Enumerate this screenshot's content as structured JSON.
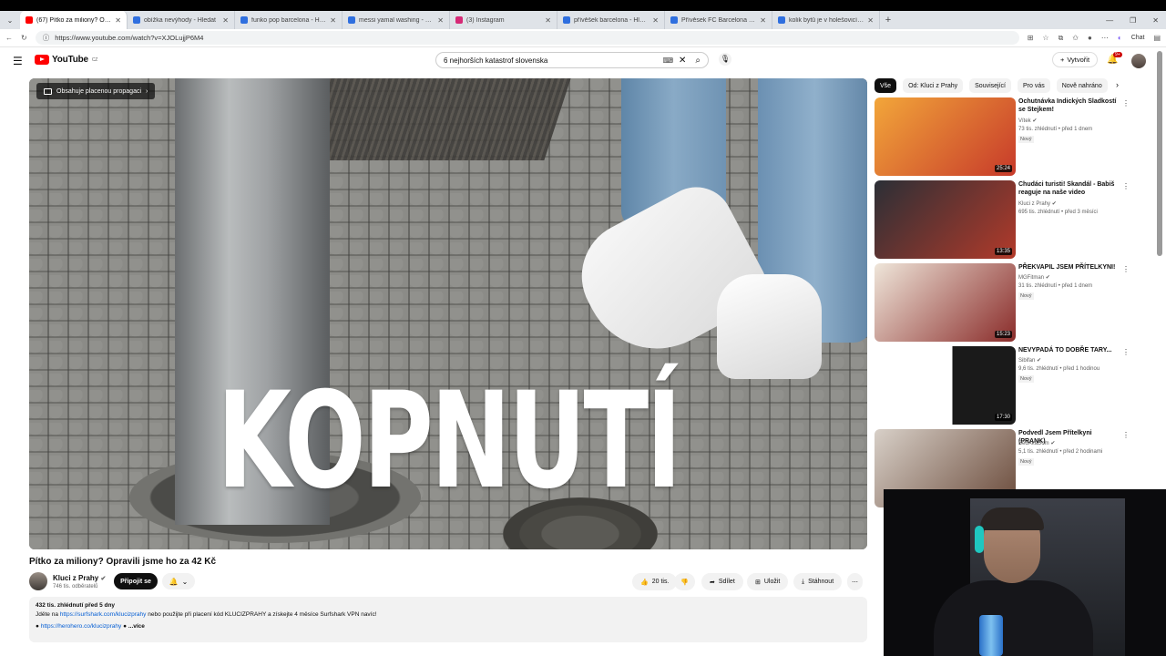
{
  "browser": {
    "tabs": [
      {
        "title": "(67) Pítko za miliony? Opravil",
        "favicon_color": "#ff0000",
        "active": true
      },
      {
        "title": "obížka nevýhody - Hledat",
        "favicon_color": "#2f6fdf"
      },
      {
        "title": "funko pop barcelona - Hledat",
        "favicon_color": "#2f6fdf"
      },
      {
        "title": "messi yamal washing - Hledat",
        "favicon_color": "#2f6fdf"
      },
      {
        "title": "(3) Instagram",
        "favicon_color": "#d62976"
      },
      {
        "title": "přívěšek barcelona - Hledat",
        "favicon_color": "#2f6fdf"
      },
      {
        "title": "Přívěsek FC Barcelona | Klíčové o",
        "favicon_color": "#2f6fdf"
      },
      {
        "title": "kolik bytů je v holešovicích - Hled",
        "favicon_color": "#2f6fdf"
      }
    ],
    "url": "https://www.youtube.com/watch?v=XJOLujjP6M4",
    "chat_label": "Chat"
  },
  "youtube": {
    "logo_text": "YouTube",
    "logo_region": "CZ",
    "search_value": "6 nejhorších katastrof slovenska",
    "create_label": "Vytvořit",
    "notifications_badge": "9+"
  },
  "video": {
    "promo_label": "Obsahuje placenou propagaci",
    "overlay_text": "KOPNUTÍ",
    "title": "Pítko za miliony? Opravili jsme ho za 42 Kč",
    "channel": "Kluci z Prahy",
    "subscribers": "746 tis. odběratelů",
    "join_label": "Připojit se",
    "likes": "20 tis.",
    "share_label": "Sdílet",
    "save_label": "Uložit",
    "download_label": "Stáhnout"
  },
  "description": {
    "meta": "432 tis. zhlédnutí  před 5 dny",
    "line_before": "Jděte na",
    "link1": "https://surfshark.com/klucizprahy",
    "line_after": "nebo použijte při placení kód KLUCIZPRAHY a získejte 4 měsíce Surfshark VPN navíc!",
    "link2": "https://herohero.co/klucizprahy",
    "more_label": "...více"
  },
  "chips": [
    "Vše",
    "Od: Kluci z Prahy",
    "Související",
    "Pro vás",
    "Nově nahráno"
  ],
  "recommendations": [
    {
      "title": "Ochutnávka Indických Sladkostí se Stejkem!",
      "channel": "Vítek",
      "views": "73 tis. zhlédnutí • před 1 dnem",
      "badge": "Nový",
      "duration": "25:24",
      "thumb": [
        "#f2a63a",
        "#c73a2a"
      ]
    },
    {
      "title": "Chudáci turisti! Skandál - Babiš reaguje na naše video",
      "channel": "Kluci z Prahy",
      "views": "695 tis. zhlédnutí • před 3 měsíci",
      "badge": "",
      "duration": "13:35",
      "thumb": [
        "#2b2f36",
        "#b23a2a"
      ]
    },
    {
      "title": "PŘEKVAPIL JSEM PŘÍTELKYNI!",
      "channel": "MGFitman",
      "views": "31 tis. zhlédnutí • před 1 dnem",
      "badge": "Nový",
      "duration": "15:23",
      "thumb": [
        "#efe6da",
        "#8a2c2a"
      ]
    },
    {
      "title": "NEVYPADÁ TO DOBŘE TARY...",
      "channel": "Sibifan",
      "views": "9,6 tis. zhlédnutí • před 1 hodinou",
      "badge": "Nový",
      "duration": "17:30",
      "thumb": [
        "#ffffff",
        "#1a1a1a"
      ]
    },
    {
      "title": "Podvedl Jsem Přítelkyni (PRANK)",
      "channel": "BedAkaDom",
      "views": "5,1 tis. zhlédnutí • před 2 hodinami",
      "badge": "Nový",
      "duration": "",
      "thumb": [
        "#d8d0c8",
        "#6a4a3a"
      ]
    }
  ]
}
